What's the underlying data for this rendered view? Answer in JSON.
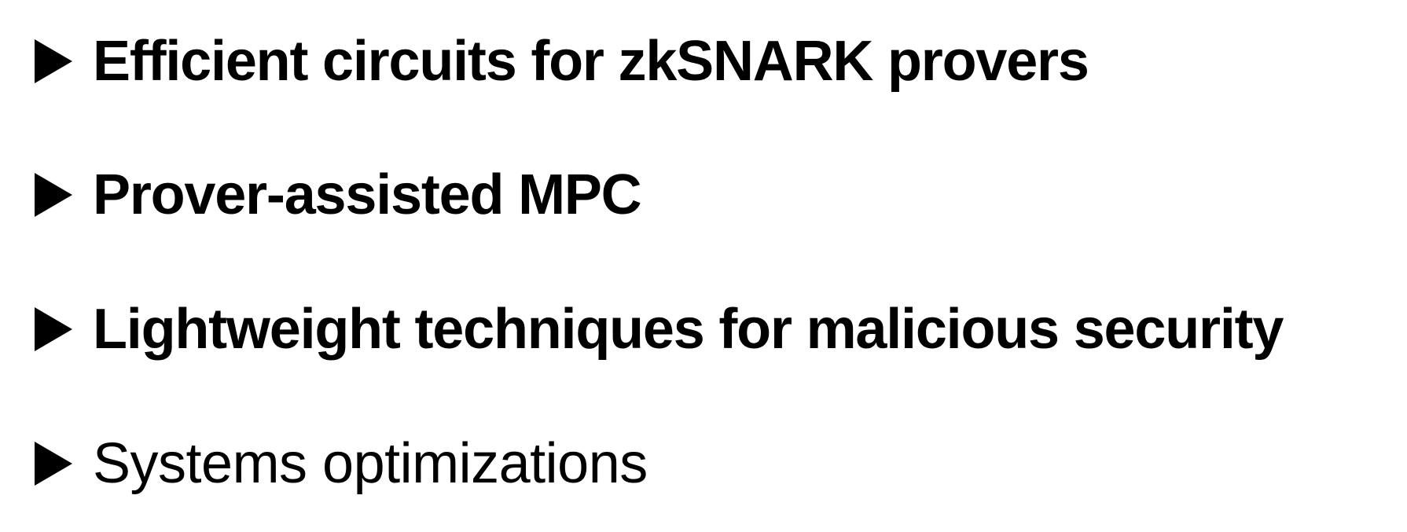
{
  "bullets": [
    {
      "icon": "play-triangle-icon",
      "text": "Efficient circuits for zkSNARK provers",
      "weight": "bold"
    },
    {
      "icon": "play-triangle-icon",
      "text": "Prover-assisted MPC",
      "weight": "bold"
    },
    {
      "icon": "play-triangle-icon",
      "text": "Lightweight techniques for malicious security",
      "weight": "bold"
    },
    {
      "icon": "play-triangle-icon",
      "text": "Systems optimizations",
      "weight": "light"
    }
  ]
}
